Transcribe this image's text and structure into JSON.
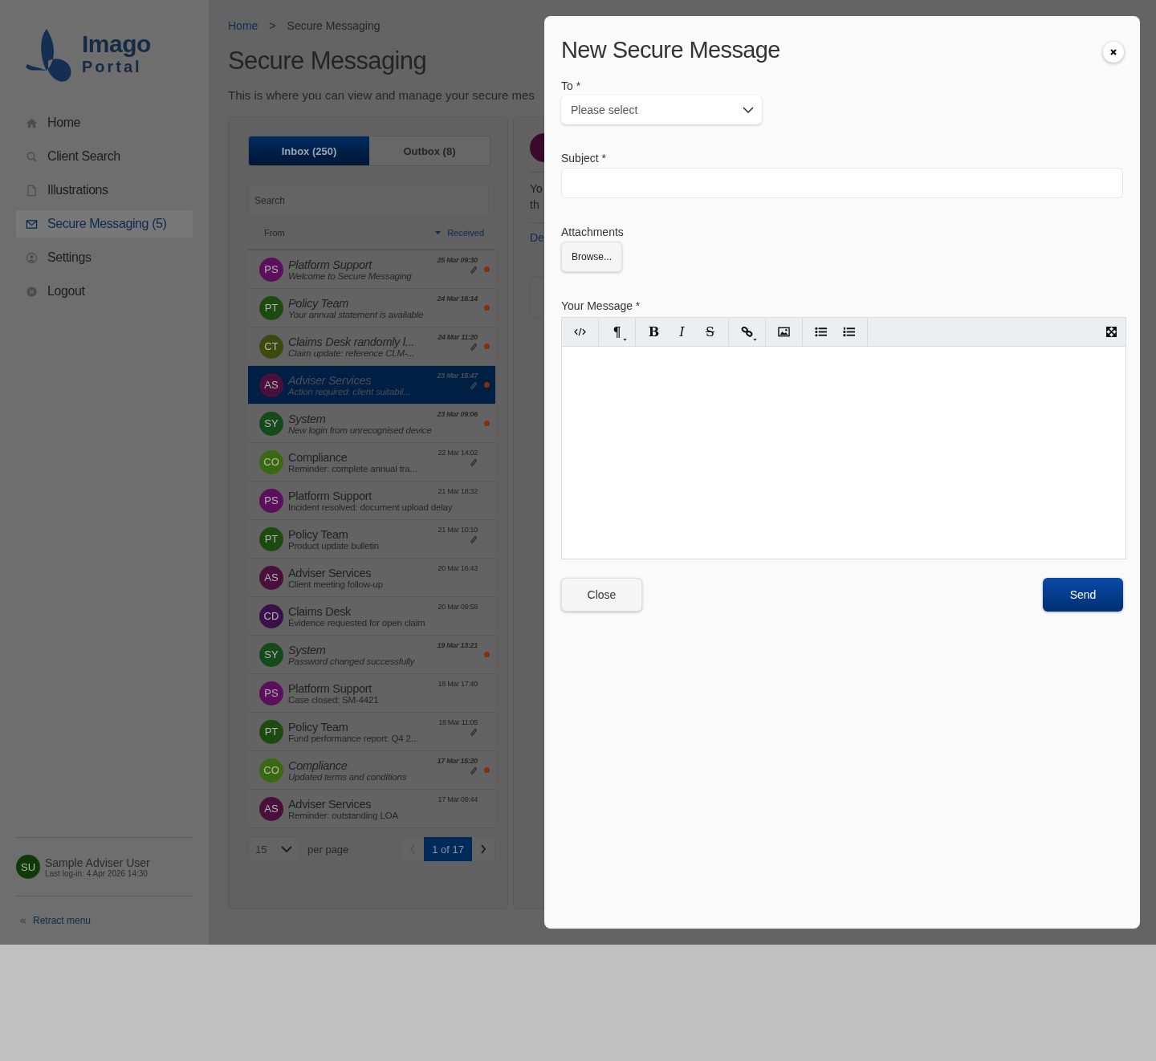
{
  "logo": {
    "name": "Imago",
    "subname": "Portal"
  },
  "sidebar": {
    "items": [
      {
        "label": "Home",
        "selected": false
      },
      {
        "label": "Client Search",
        "selected": false
      },
      {
        "label": "Illustrations",
        "selected": false
      },
      {
        "label": "Secure Messaging (5)",
        "selected": true
      },
      {
        "label": "Settings",
        "selected": false
      },
      {
        "label": "Logout",
        "selected": false
      }
    ],
    "user": {
      "initials": "SU",
      "name": "Sample Adviser User",
      "last_login": "Last log-in: 4 Apr 2026 14:30"
    },
    "retract": "Retract menu"
  },
  "breadcrumb": {
    "home": "Home",
    "separator": ">",
    "current": "Secure Messaging"
  },
  "page_title": "Secure Messaging",
  "page_subtitle": "This is where you can view and manage your secure mes",
  "tabs": [
    {
      "label": "Inbox (250)",
      "selected": true
    },
    {
      "label": "Outbox (8)",
      "selected": false
    }
  ],
  "search": {
    "placeholder": "Search"
  },
  "list_header": {
    "from": "From",
    "received": "Received"
  },
  "messages": [
    {
      "initials": "PS",
      "color": "#5c0f5c",
      "sender": "Platform Support",
      "subject": "Welcome to Secure Messaging",
      "time": "25 Mar 09:30",
      "attachment": true,
      "unread": true,
      "selected": false
    },
    {
      "initials": "PT",
      "color": "#1d4a10",
      "sender": "Policy Team",
      "subject": "Your annual statement is available",
      "time": "24 Mar 16:14",
      "attachment": false,
      "unread": true,
      "selected": false
    },
    {
      "initials": "CT",
      "color": "#3c4a10",
      "sender": "Claims Desk randomly l...",
      "subject": "Claim update: reference CLM-...",
      "time": "24 Mar 11:20",
      "attachment": true,
      "unread": true,
      "selected": false
    },
    {
      "initials": "AS",
      "color": "#4a0f3a",
      "sender": "Adviser Services",
      "subject": "Action required: client suitabil...",
      "time": "23 Mar 15:47",
      "attachment": true,
      "unread": true,
      "selected": true
    },
    {
      "initials": "SY",
      "color": "#154a1a",
      "sender": "System",
      "subject": "New login from unrecognised device",
      "time": "23 Mar 09:06",
      "attachment": false,
      "unread": true,
      "selected": false
    },
    {
      "initials": "CO",
      "color": "#3a6a10",
      "sender": "Compliance",
      "subject": "Reminder: complete annual tra...",
      "time": "22 Mar 14:02",
      "attachment": true,
      "unread": false,
      "selected": false
    },
    {
      "initials": "PS",
      "color": "#5c0f5c",
      "sender": "Platform Support",
      "subject": "Incident resolved: document upload delay",
      "time": "21 Mar 18:32",
      "attachment": false,
      "unread": false,
      "selected": false
    },
    {
      "initials": "PT",
      "color": "#1d4a10",
      "sender": "Policy Team",
      "subject": "Product update bulletin",
      "time": "21 Mar 10:10",
      "attachment": true,
      "unread": false,
      "selected": false
    },
    {
      "initials": "AS",
      "color": "#4a0f3a",
      "sender": "Adviser Services",
      "subject": "Client meeting follow-up",
      "time": "20 Mar 16:43",
      "attachment": false,
      "unread": false,
      "selected": false
    },
    {
      "initials": "CD",
      "color": "#3a0f4a",
      "sender": "Claims Desk",
      "subject": "Evidence requested for open claim",
      "time": "20 Mar 09:58",
      "attachment": false,
      "unread": false,
      "selected": false
    },
    {
      "initials": "SY",
      "color": "#154a1a",
      "sender": "System",
      "subject": "Password changed successfully",
      "time": "19 Mar 13:21",
      "attachment": false,
      "unread": true,
      "selected": false
    },
    {
      "initials": "PS",
      "color": "#5c0f5c",
      "sender": "Platform Support",
      "subject": "Case closed: SM-4421",
      "time": "18 Mar 17:40",
      "attachment": false,
      "unread": false,
      "selected": false
    },
    {
      "initials": "PT",
      "color": "#1d4a10",
      "sender": "Policy Team",
      "subject": "Fund performance report: Q4 2...",
      "time": "18 Mar 11:05",
      "attachment": true,
      "unread": false,
      "selected": false
    },
    {
      "initials": "CO",
      "color": "#3a6a10",
      "sender": "Compliance",
      "subject": "Updated terms and conditions",
      "time": "17 Mar 15:20",
      "attachment": true,
      "unread": true,
      "selected": false
    },
    {
      "initials": "AS",
      "color": "#4a0f3a",
      "sender": "Adviser Services",
      "subject": "Reminder: outstanding LOA",
      "time": "17 Mar 09:44",
      "attachment": false,
      "unread": false,
      "selected": false
    }
  ],
  "pagination": {
    "per_page_value": "15",
    "per_page_label": "per page",
    "page": "1 of 17"
  },
  "detail_fragment": {
    "line_1": "Yo",
    "line_2": "th",
    "link": "De"
  },
  "modal": {
    "title": "New Secure Message",
    "to": {
      "label": "To *",
      "placeholder": "Please select"
    },
    "subject": {
      "label": "Subject *"
    },
    "attachments": {
      "label": "Attachments",
      "button": "Browse..."
    },
    "message": {
      "label": "Your Message *"
    },
    "toolbar": [
      [
        {
          "kind": "code"
        }
      ],
      [
        {
          "kind": "paragraph",
          "label": "¶"
        }
      ],
      [
        {
          "kind": "bold",
          "label": "B"
        },
        {
          "kind": "italic",
          "label": "I"
        },
        {
          "kind": "strike",
          "label": "S"
        }
      ],
      [
        {
          "kind": "link"
        }
      ],
      [
        {
          "kind": "image"
        }
      ],
      [
        {
          "kind": "bullets"
        },
        {
          "kind": "numbers"
        }
      ]
    ],
    "close": "Close",
    "send": "Send"
  }
}
